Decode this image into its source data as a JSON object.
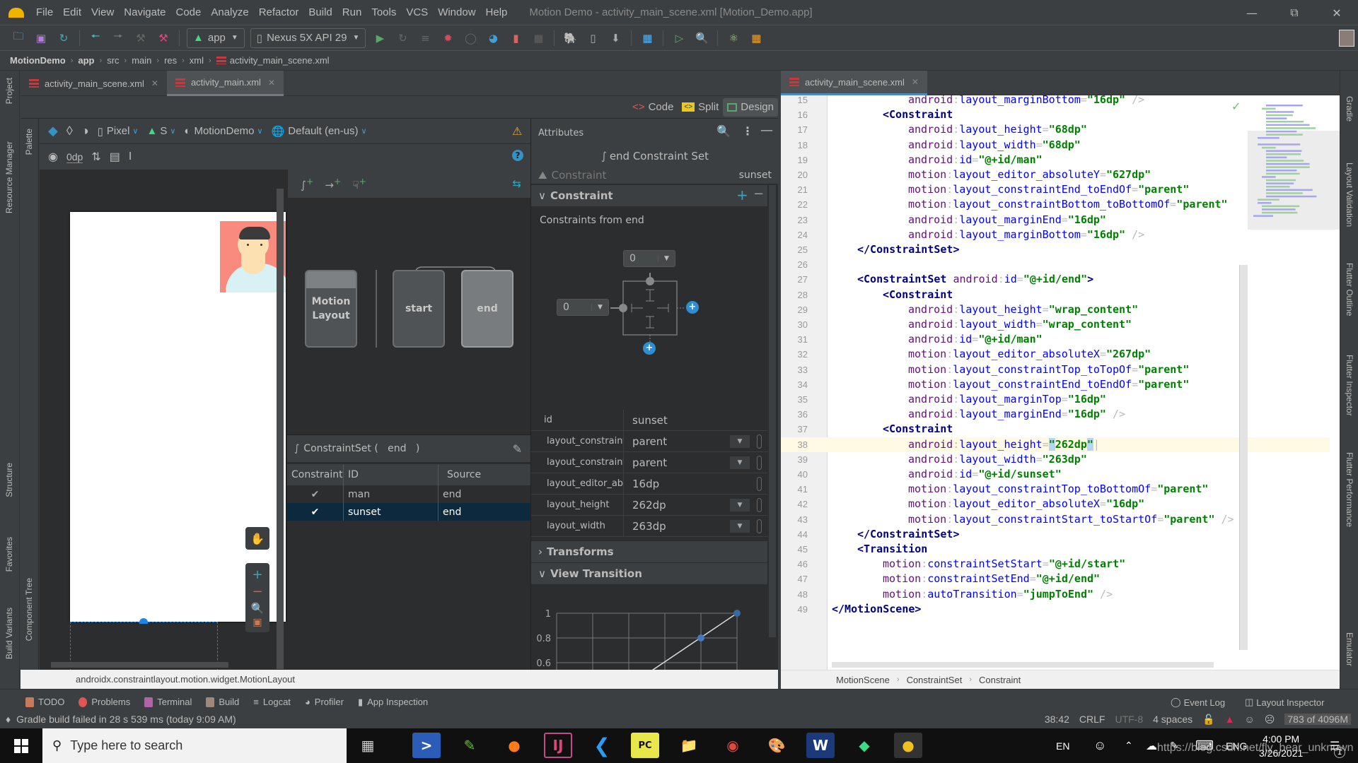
{
  "window": {
    "title": "Motion Demo - activity_main_scene.xml [Motion_Demo.app]",
    "menu": [
      "File",
      "Edit",
      "View",
      "Navigate",
      "Code",
      "Analyze",
      "Refactor",
      "Build",
      "Run",
      "Tools",
      "VCS",
      "Window",
      "Help"
    ]
  },
  "toolbar": {
    "run_config": "app",
    "device": "Nexus 5X API 29"
  },
  "breadcrumb": [
    "MotionDemo",
    "app",
    "src",
    "main",
    "res",
    "xml",
    "activity_main_scene.xml"
  ],
  "left_strip": {
    "project": "Project",
    "resource_manager": "Resource Manager",
    "structure": "Structure",
    "favorites": "Favorites",
    "build_variants": "Build Variants"
  },
  "palette_strip": {
    "palette": "Palette",
    "component_tree": "Component Tree"
  },
  "right_strip": {
    "gradle": "Gradle",
    "layout_validation": "Layout Validation",
    "flutter_outline": "Flutter Outline",
    "flutter_inspector": "Flutter Inspector",
    "flutter_performance": "Flutter Performance",
    "emulator": "Emulator"
  },
  "left_tabs": [
    {
      "label": "activity_main_scene.xml",
      "active": false
    },
    {
      "label": "activity_main.xml",
      "active": true
    }
  ],
  "view_modes": {
    "code": "Code",
    "split": "Split",
    "design": "Design",
    "active": "Design"
  },
  "design_toolbar": {
    "device": "Pixel",
    "api": "S",
    "theme": "MotionDemo",
    "locale": "Default (en-us)",
    "margin": "0dp"
  },
  "motion_editor": {
    "nodes": {
      "motion_layout": "Motion\nLayout",
      "start": "start",
      "end": "end"
    },
    "constraint_set_title": "ConstraintSet (   end   )",
    "table": {
      "headers": [
        "Constraint",
        "ID",
        "Source"
      ],
      "rows": [
        {
          "check": "✔",
          "id": "man",
          "source": "end",
          "selected": false
        },
        {
          "check": "✔",
          "id": "sunset",
          "source": "end",
          "selected": true
        }
      ]
    }
  },
  "attributes": {
    "header": "Attributes",
    "title": "end Constraint Set",
    "sub_label": "Constraint",
    "sub_value": "sunset",
    "section_constraint": "Constraint",
    "constraints_from": "Constraints from end",
    "widget": {
      "top_margin": "0",
      "start_margin": "0"
    },
    "props": [
      {
        "key": "id",
        "value": "sunset",
        "dropdown": false,
        "pin": false
      },
      {
        "key": "layout_constraint...",
        "value": "parent",
        "dropdown": true,
        "pin": true
      },
      {
        "key": "layout_constraint...",
        "value": "parent",
        "dropdown": true,
        "pin": true
      },
      {
        "key": "layout_editor_abs...",
        "value": "16dp",
        "dropdown": false,
        "pin": true
      },
      {
        "key": "layout_height",
        "value": "262dp",
        "dropdown": true,
        "pin": true
      },
      {
        "key": "layout_width",
        "value": "263dp",
        "dropdown": true,
        "pin": true
      }
    ],
    "section_transforms": "Transforms",
    "section_view_transition": "View Transition",
    "graph_ticks": [
      "1",
      "0.8",
      "0.6"
    ]
  },
  "editor": {
    "tab": "activity_main_scene.xml",
    "lines": [
      {
        "n": "15",
        "html": "<span class='an'>android</span>:<span class='ak'>layout_marginBottom</span>=<span class='av'>\"16dp\"</span> />",
        "indent": 3
      },
      {
        "n": "16",
        "html": "<span class='tag'>&lt;Constraint</span>",
        "indent": 2
      },
      {
        "n": "17",
        "html": "<span class='an'>android</span>:<span class='ak'>layout_height</span>=<span class='av'>\"68dp\"</span>",
        "indent": 3
      },
      {
        "n": "18",
        "html": "<span class='an'>android</span>:<span class='ak'>layout_width</span>=<span class='av'>\"68dp\"</span>",
        "indent": 3
      },
      {
        "n": "19",
        "html": "<span class='an'>android</span>:<span class='ak'>id</span>=<span class='av'>\"@+id/man\"</span>",
        "indent": 3
      },
      {
        "n": "20",
        "html": "<span class='an'>motion</span>:<span class='ak'>layout_editor_absoluteY</span>=<span class='av'>\"627dp\"</span>",
        "indent": 3
      },
      {
        "n": "21",
        "html": "<span class='an'>motion</span>:<span class='ak'>layout_constraintEnd_toEndOf</span>=<span class='av'>\"parent\"</span>",
        "indent": 3
      },
      {
        "n": "22",
        "html": "<span class='an'>motion</span>:<span class='ak'>layout_constraintBottom_toBottomOf</span>=<span class='av'>\"parent\"</span>",
        "indent": 3
      },
      {
        "n": "23",
        "html": "<span class='an'>android</span>:<span class='ak'>layout_marginEnd</span>=<span class='av'>\"16dp\"</span>",
        "indent": 3
      },
      {
        "n": "24",
        "html": "<span class='an'>android</span>:<span class='ak'>layout_marginBottom</span>=<span class='av'>\"16dp\"</span> />",
        "indent": 3
      },
      {
        "n": "25",
        "html": "<span class='tag'>&lt;/ConstraintSet&gt;</span>",
        "indent": 1
      },
      {
        "n": "26",
        "html": "",
        "indent": 0
      },
      {
        "n": "27",
        "html": "<span class='tag'>&lt;ConstraintSet</span> <span class='an'>android</span>:<span class='ak'>id</span>=<span class='av'>\"@+id/end\"</span><span class='tag'>&gt;</span>",
        "indent": 1
      },
      {
        "n": "28",
        "html": "<span class='tag'>&lt;Constraint</span>",
        "indent": 2
      },
      {
        "n": "29",
        "html": "<span class='an'>android</span>:<span class='ak'>layout_height</span>=<span class='av'>\"wrap_content\"</span>",
        "indent": 3
      },
      {
        "n": "30",
        "html": "<span class='an'>android</span>:<span class='ak'>layout_width</span>=<span class='av'>\"wrap_content\"</span>",
        "indent": 3
      },
      {
        "n": "31",
        "html": "<span class='an'>android</span>:<span class='ak'>id</span>=<span class='av'>\"@+id/man\"</span>",
        "indent": 3
      },
      {
        "n": "32",
        "html": "<span class='an'>motion</span>:<span class='ak'>layout_editor_absoluteX</span>=<span class='av'>\"267dp\"</span>",
        "indent": 3
      },
      {
        "n": "33",
        "html": "<span class='an'>motion</span>:<span class='ak'>layout_constraintTop_toTopOf</span>=<span class='av'>\"parent\"</span>",
        "indent": 3
      },
      {
        "n": "34",
        "html": "<span class='an'>motion</span>:<span class='ak'>layout_constraintEnd_toEndOf</span>=<span class='av'>\"parent\"</span>",
        "indent": 3
      },
      {
        "n": "35",
        "html": "<span class='an'>android</span>:<span class='ak'>layout_marginTop</span>=<span class='av'>\"16dp\"</span>",
        "indent": 3
      },
      {
        "n": "36",
        "html": "<span class='an'>android</span>:<span class='ak'>layout_marginEnd</span>=<span class='av'>\"16dp\"</span> />",
        "indent": 3
      },
      {
        "n": "37",
        "html": "<span class='tag'>&lt;Constraint</span>",
        "indent": 2
      },
      {
        "n": "38",
        "html": "<span class='an'>android</span>:<span class='ak'>layout_height</span>=<span class='av'><span style='background:#b3d7f3'>\"</span>262dp<span style='background:#b3d7f3'>\"</span></span>|",
        "indent": 3,
        "current": true
      },
      {
        "n": "39",
        "html": "<span class='an'>android</span>:<span class='ak'>layout_width</span>=<span class='av'>\"263dp\"</span>",
        "indent": 3
      },
      {
        "n": "40",
        "html": "<span class='an'>android</span>:<span class='ak'>id</span>=<span class='av'>\"@+id/sunset\"</span>",
        "indent": 3
      },
      {
        "n": "41",
        "html": "<span class='an'>motion</span>:<span class='ak'>layout_constraintTop_toBottomOf</span>=<span class='av'>\"parent\"</span>",
        "indent": 3
      },
      {
        "n": "42",
        "html": "<span class='an'>motion</span>:<span class='ak'>layout_editor_absoluteX</span>=<span class='av'>\"16dp\"</span>",
        "indent": 3
      },
      {
        "n": "43",
        "html": "<span class='an'>motion</span>:<span class='ak'>layout_constraintStart_toStartOf</span>=<span class='av'>\"parent\"</span> />",
        "indent": 3
      },
      {
        "n": "44",
        "html": "<span class='tag'>&lt;/ConstraintSet&gt;</span>",
        "indent": 1
      },
      {
        "n": "45",
        "html": "<span class='tag'>&lt;Transition</span>",
        "indent": 1
      },
      {
        "n": "46",
        "html": "<span class='an'>motion</span>:<span class='ak'>constraintSetStart</span>=<span class='av'>\"@+id/start\"</span>",
        "indent": 2
      },
      {
        "n": "47",
        "html": "<span class='an'>motion</span>:<span class='ak'>constraintSetEnd</span>=<span class='av'>\"@+id/end\"</span>",
        "indent": 2
      },
      {
        "n": "48",
        "html": "<span class='an'>motion</span>:<span class='ak'>autoTransition</span>=<span class='av'>\"jumpToEnd\"</span> />",
        "indent": 2
      },
      {
        "n": "49",
        "html": "<span class='tag'>&lt;/MotionScene&gt;</span>",
        "indent": 0
      }
    ],
    "breadcrumb": [
      "MotionScene",
      "ConstraintSet",
      "Constraint"
    ]
  },
  "design_status": "androidx.constraintlayout.motion.widget.MotionLayout",
  "bottom_tools": [
    {
      "label": "TODO",
      "color": "#c57a5a"
    },
    {
      "label": "Problems",
      "color": "#e05555"
    },
    {
      "label": "Terminal",
      "color": "#b065a8"
    },
    {
      "label": "Build",
      "color": "#a08878"
    },
    {
      "label": "Logcat",
      "color": "#bbbbbb"
    },
    {
      "label": "Profiler",
      "color": "#bbbbbb"
    },
    {
      "label": "App Inspection",
      "color": "#bbbbbb"
    }
  ],
  "bottom_right_tools": {
    "event_log": "Event Log",
    "layout_inspector": "Layout Inspector"
  },
  "status": {
    "message": "Gradle build failed in 28 s 539 ms (today 9:09 AM)",
    "position": "38:42",
    "line_sep": "CRLF",
    "encoding": "UTF-8",
    "indent": "4 spaces",
    "memory": "783 of 4096M"
  },
  "taskbar": {
    "search_placeholder": "Type here to search",
    "lang": "EN",
    "ime": "ENG",
    "time": "4:00 PM",
    "date": "3/26/2021",
    "notifications": "1",
    "watermark": "https://blog.csdn.net/fly_bear_unknown"
  },
  "colors": {
    "accent": "#4a88c7",
    "selection": "#0d293e",
    "error": "#e0245e"
  }
}
